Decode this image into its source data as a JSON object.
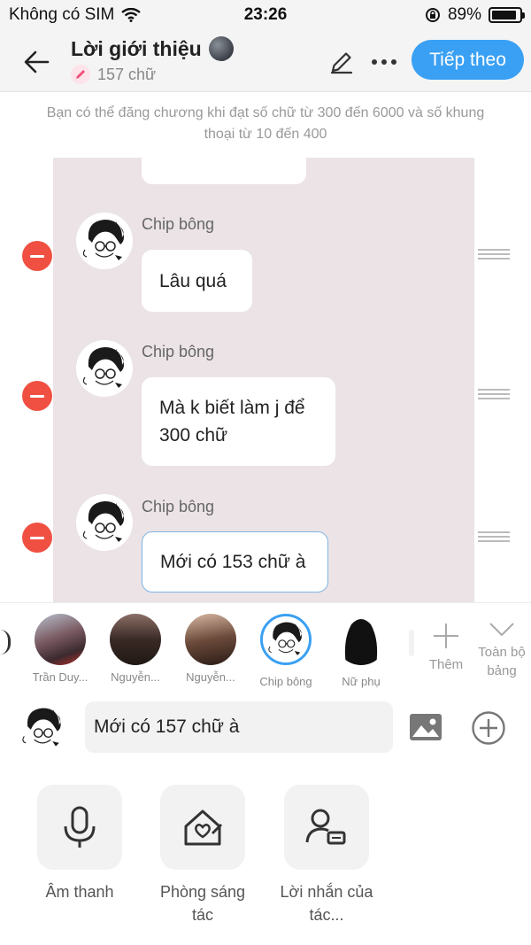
{
  "status_bar": {
    "carrier": "Không có SIM",
    "time": "23:26",
    "battery": "89%",
    "battery_level": 0.89
  },
  "header": {
    "title": "Lời giới thiệu",
    "word_count": "157 chữ",
    "next_label": "Tiếp theo"
  },
  "info_text": "Bạn có thể đăng chương khi đạt số chữ từ 300 đến 6000 và số khung thoại từ 10 đến 400",
  "chat": {
    "messages": [
      {
        "sender": "Chip bông",
        "text": "Lâu quá"
      },
      {
        "sender": "Chip bông",
        "text": "Mà k biết làm j để 300 chữ"
      },
      {
        "sender": "Chip bông",
        "text": "Mới có 153 chữ à"
      }
    ]
  },
  "characters": [
    {
      "name": "Trần Duy..."
    },
    {
      "name": "Nguyễn..."
    },
    {
      "name": "Nguyễn..."
    },
    {
      "name": "Chip bông"
    },
    {
      "name": "Nữ phụ"
    }
  ],
  "char_actions": {
    "add_label": "Thêm",
    "all_label": "Toàn bộ bảng"
  },
  "composer": {
    "input_value": "Mới có 157 chữ à"
  },
  "tools": [
    {
      "label": "Âm thanh"
    },
    {
      "label": "Phòng sáng tác"
    },
    {
      "label": "Lời nhắn của tác..."
    }
  ],
  "colors": {
    "accent": "#3aa0f3",
    "delete": "#f05042",
    "chat_background": "#ebe3e5"
  }
}
